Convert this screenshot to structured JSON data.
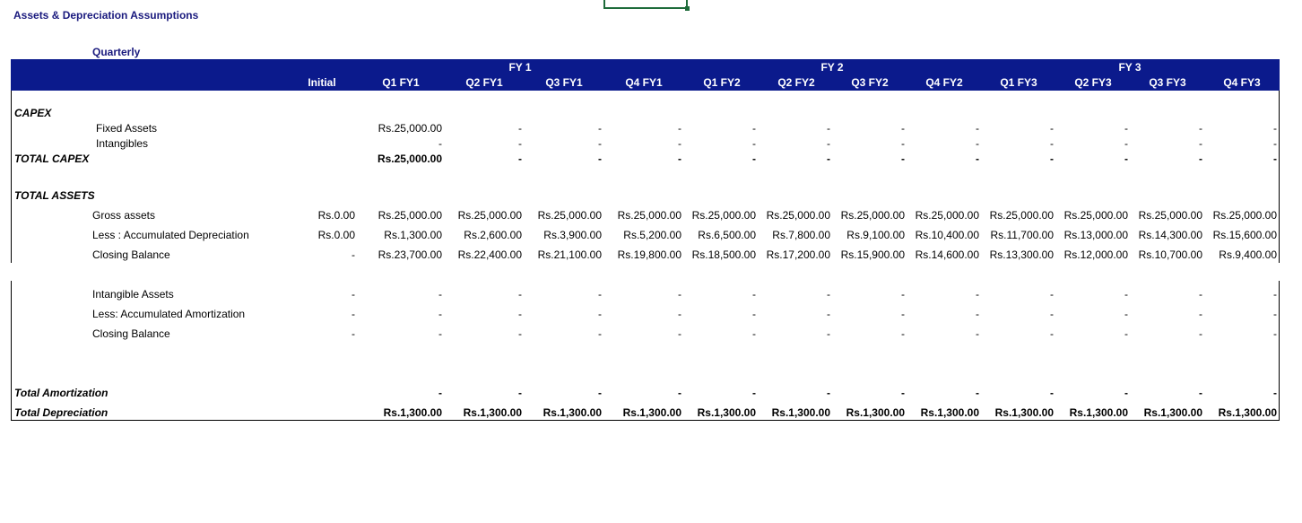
{
  "sheet": {
    "title": "Assets & Depreciation Assumptions",
    "period_label": "Quarterly"
  },
  "header": {
    "fy_groups": [
      "FY 1",
      "FY 2",
      "FY 3"
    ],
    "columns": [
      "Initial",
      "Q1 FY1",
      "Q2 FY1",
      "Q3 FY1",
      "Q4 FY1",
      "Q1 FY2",
      "Q2 FY2",
      "Q3 FY2",
      "Q4 FY2",
      "Q1 FY3",
      "Q2 FY3",
      "Q3 FY3",
      "Q4 FY3"
    ]
  },
  "colors": {
    "header_bg": "#0b1a8c",
    "header_text": "#ffffff",
    "title_text": "#1a1a7e",
    "cell_cursor": "#1e6b3a"
  },
  "rows": [
    {
      "id": "capex",
      "label": "CAPEX",
      "kind": "section",
      "values": []
    },
    {
      "id": "fixed-assets",
      "label": "Fixed Assets",
      "kind": "item-deep",
      "values": [
        "",
        "Rs.25,000.00",
        "-",
        "-",
        "-",
        "-",
        "-",
        "-",
        "-",
        "-",
        "-",
        "-",
        "-"
      ]
    },
    {
      "id": "intangibles",
      "label": "Intangibles",
      "kind": "item-deep",
      "values": [
        "",
        "-",
        "-",
        "-",
        "-",
        "-",
        "-",
        "-",
        "-",
        "-",
        "-",
        "-",
        "-"
      ]
    },
    {
      "id": "total-capex",
      "label": "TOTAL CAPEX",
      "kind": "section-total",
      "values": [
        "",
        "Rs.25,000.00",
        "-",
        "-",
        "-",
        "-",
        "-",
        "-",
        "-",
        "-",
        "-",
        "-",
        "-"
      ]
    },
    {
      "id": "total-assets",
      "label": "TOTAL ASSETS",
      "kind": "section",
      "values": []
    },
    {
      "id": "gross-assets",
      "label": "Gross assets",
      "kind": "item",
      "values": [
        "Rs.0.00",
        "Rs.25,000.00",
        "Rs.25,000.00",
        "Rs.25,000.00",
        "Rs.25,000.00",
        "Rs.25,000.00",
        "Rs.25,000.00",
        "Rs.25,000.00",
        "Rs.25,000.00",
        "Rs.25,000.00",
        "Rs.25,000.00",
        "Rs.25,000.00",
        "Rs.25,000.00"
      ]
    },
    {
      "id": "accum-depreciation",
      "label": "Less : Accumulated Depreciation",
      "kind": "item",
      "values": [
        "Rs.0.00",
        "Rs.1,300.00",
        "Rs.2,600.00",
        "Rs.3,900.00",
        "Rs.5,200.00",
        "Rs.6,500.00",
        "Rs.7,800.00",
        "Rs.9,100.00",
        "Rs.10,400.00",
        "Rs.11,700.00",
        "Rs.13,000.00",
        "Rs.14,300.00",
        "Rs.15,600.00"
      ]
    },
    {
      "id": "closing-balance-assets",
      "label": "Closing Balance",
      "kind": "item",
      "values": [
        "-",
        "Rs.23,700.00",
        "Rs.22,400.00",
        "Rs.21,100.00",
        "Rs.19,800.00",
        "Rs.18,500.00",
        "Rs.17,200.00",
        "Rs.15,900.00",
        "Rs.14,600.00",
        "Rs.13,300.00",
        "Rs.12,000.00",
        "Rs.10,700.00",
        "Rs.9,400.00"
      ]
    },
    {
      "id": "intangible-assets",
      "label": "Intangible Assets",
      "kind": "item",
      "values": [
        "-",
        "-",
        "-",
        "-",
        "-",
        "-",
        "-",
        "-",
        "-",
        "-",
        "-",
        "-",
        "-"
      ]
    },
    {
      "id": "accum-amortization",
      "label": "Less: Accumulated Amortization",
      "kind": "item",
      "values": [
        "-",
        "-",
        "-",
        "-",
        "-",
        "-",
        "-",
        "-",
        "-",
        "-",
        "-",
        "-",
        "-"
      ]
    },
    {
      "id": "closing-balance-intangibles",
      "label": "Closing Balance",
      "kind": "item",
      "values": [
        "-",
        "-",
        "-",
        "-",
        "-",
        "-",
        "-",
        "-",
        "-",
        "-",
        "-",
        "-",
        "-"
      ]
    },
    {
      "id": "total-amortization",
      "label": "Total Amortization",
      "kind": "total-small",
      "values": [
        "",
        "-",
        "-",
        "-",
        "-",
        "-",
        "-",
        "-",
        "-",
        "-",
        "-",
        "-",
        "-"
      ]
    },
    {
      "id": "total-depreciation",
      "label": "Total Depreciation",
      "kind": "total-small",
      "values": [
        "",
        "Rs.1,300.00",
        "Rs.1,300.00",
        "Rs.1,300.00",
        "Rs.1,300.00",
        "Rs.1,300.00",
        "Rs.1,300.00",
        "Rs.1,300.00",
        "Rs.1,300.00",
        "Rs.1,300.00",
        "Rs.1,300.00",
        "Rs.1,300.00",
        "Rs.1,300.00"
      ]
    }
  ]
}
